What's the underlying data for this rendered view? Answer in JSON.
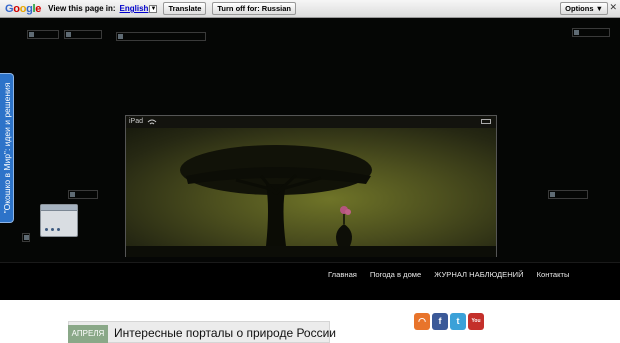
{
  "translate_bar": {
    "logo": {
      "G1": "G",
      "o1": "o",
      "o2": "o",
      "g": "g",
      "l": "l",
      "e": "e"
    },
    "prompt": "View this page in:",
    "language": "English",
    "translate_button": "Translate",
    "turn_off_button": "Turn off for: Russian",
    "options_button": "Options ▼",
    "close": "✕"
  },
  "sidebar_tab": {
    "label": "\"Окошко в Мир\": идеи и решения"
  },
  "ipad": {
    "status_text": "iPad"
  },
  "nav": {
    "items": [
      "Главная",
      "Погода в доме",
      "ЖУРНАЛ НАБЛЮДЕНИЙ",
      "Контакты"
    ]
  },
  "post": {
    "date_label": "АПРЕЛЯ",
    "title": "Интересные порталы о природе России"
  },
  "social": {
    "rss": "◠",
    "facebook": "f",
    "twitter": "t",
    "youtube": "You Tube"
  },
  "colors": {
    "sidebar_tab": "#2d73c9",
    "date_tab": "#8aa888",
    "rss": "#e8742b",
    "facebook": "#3b5998",
    "twitter": "#3ba1d8",
    "youtube": "#c4302b"
  }
}
